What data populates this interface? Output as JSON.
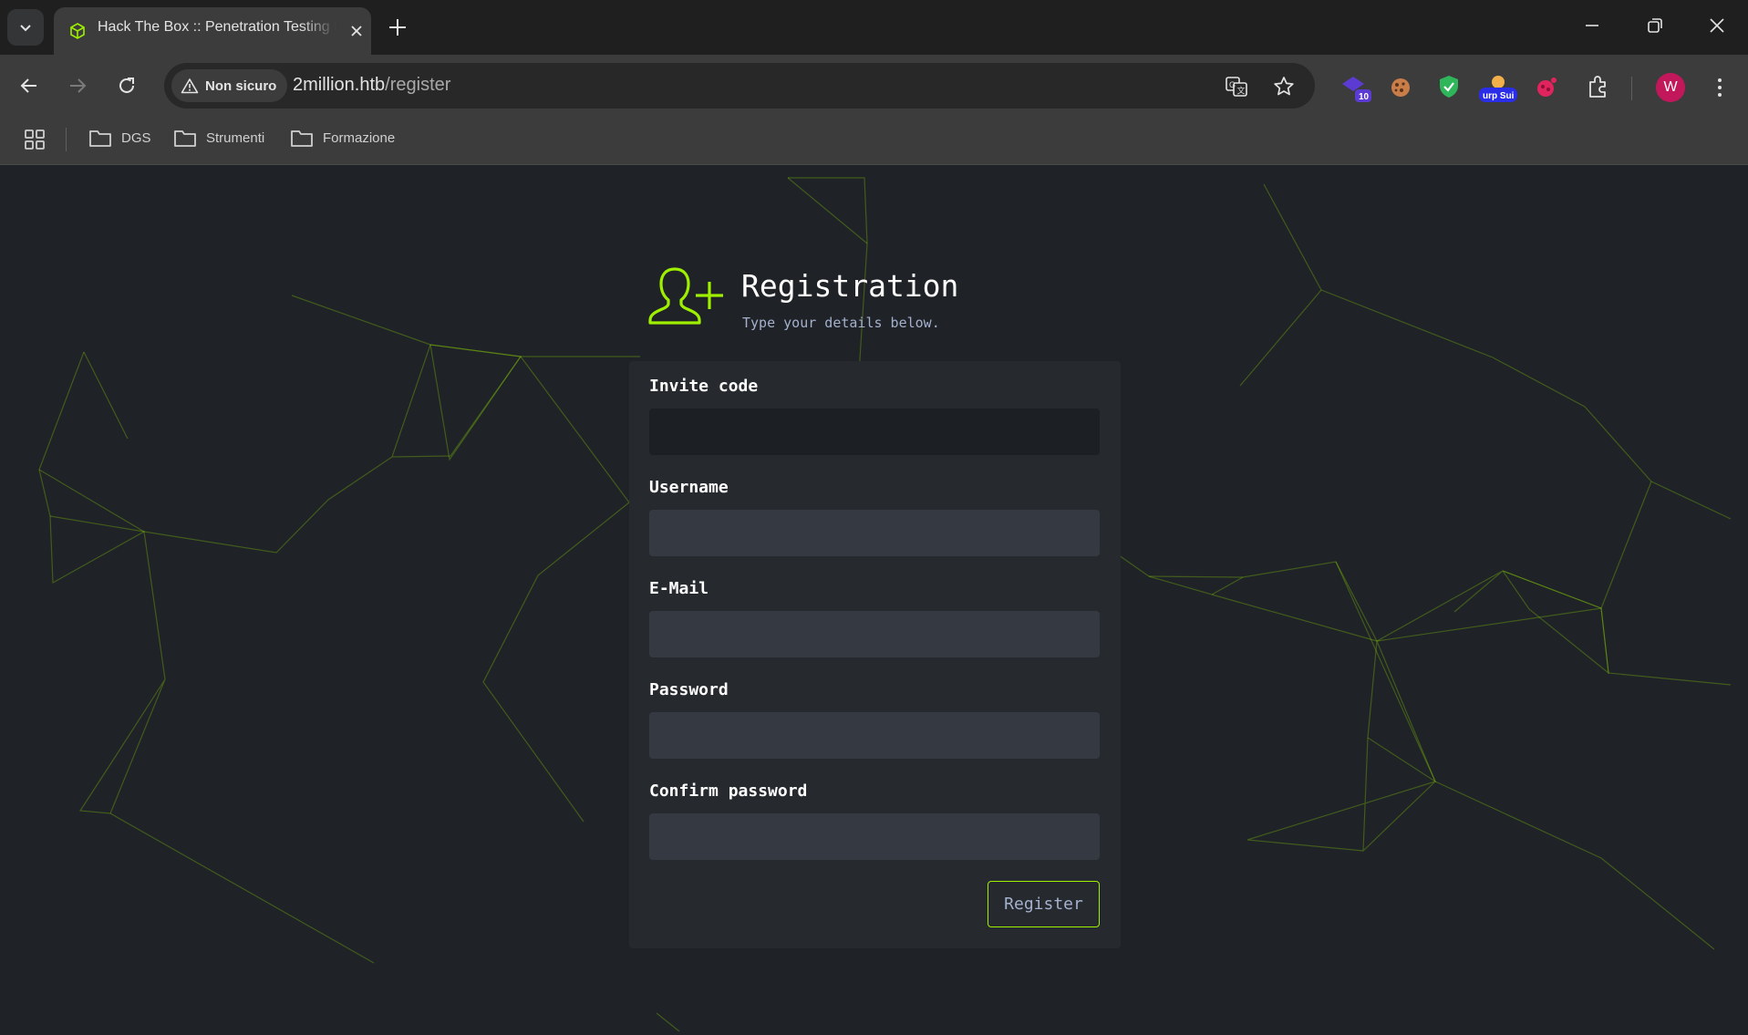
{
  "browser": {
    "tab_title": "Hack The Box :: Penetration Testing Labs",
    "not_secure_label": "Non sicuro",
    "url_host": "2million.htb",
    "url_path": "/register",
    "extension_badges": [
      "10",
      "urp Sui"
    ],
    "profile_initial": "W",
    "bookmarks": [
      "DGS",
      "Strumenti",
      "Formazione"
    ]
  },
  "page": {
    "title": "Registration",
    "subtitle": "Type your details below.",
    "fields": [
      {
        "label": "Invite code",
        "value": ""
      },
      {
        "label": "Username",
        "value": ""
      },
      {
        "label": "E-Mail",
        "value": ""
      },
      {
        "label": "Password",
        "value": ""
      },
      {
        "label": "Confirm password",
        "value": ""
      }
    ],
    "submit_label": "Register"
  },
  "colors": {
    "accent": "#9fef00",
    "page_bg": "#1f2227",
    "card_bg": "#262a2f",
    "input_bg": "#353a42",
    "muted_text": "#a4b1cd"
  }
}
